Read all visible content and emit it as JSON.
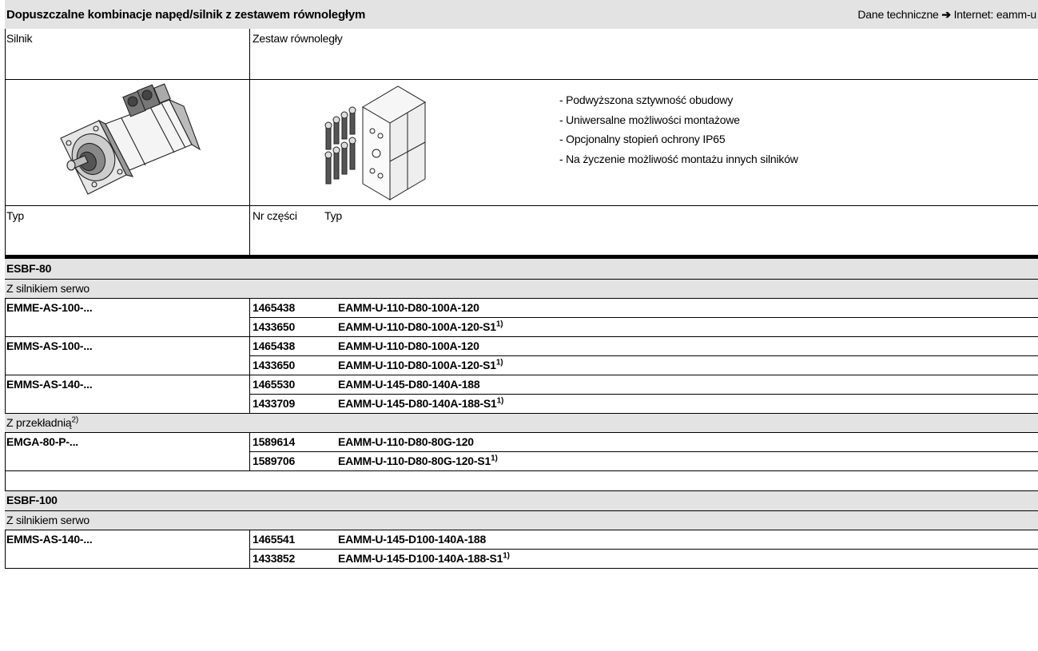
{
  "header": {
    "title": "Dopuszczalne kombinacje napęd/silnik z zestawem równoległym",
    "ref_prefix": "Dane techniczne",
    "ref_arrow": "➔",
    "ref_suffix": "Internet: eamm-u"
  },
  "columns": {
    "motor": "Silnik",
    "kit": "Zestaw równoległy",
    "type_left": "Typ",
    "part_no": "Nr części",
    "type_right": "Typ"
  },
  "features": [
    "- Podwyższona sztywność obudowy",
    "- Uniwersalne możliwości montażowe",
    "- Opcjonalny stopień ochrony IP65",
    "- Na życzenie możliwość montażu innych silników"
  ],
  "sections": {
    "esbf80": {
      "title": "ESBF-80",
      "servo_label": "Z silnikiem serwo",
      "gear_label": "Z przekładnią",
      "gear_note": "2)",
      "rows": [
        {
          "motor": "EMME-AS-100-...",
          "part": "1465438",
          "type": "EAMM-U-110-D80-100A-120",
          "note": ""
        },
        {
          "motor": "",
          "part": "1433650",
          "type": "EAMM-U-110-D80-100A-120-S1",
          "note": "1)"
        },
        {
          "motor": "EMMS-AS-100-...",
          "part": "1465438",
          "type": "EAMM-U-110-D80-100A-120",
          "note": ""
        },
        {
          "motor": "",
          "part": "1433650",
          "type": "EAMM-U-110-D80-100A-120-S1",
          "note": "1)"
        },
        {
          "motor": "EMMS-AS-140-...",
          "part": "1465530",
          "type": "EAMM-U-145-D80-140A-188",
          "note": ""
        },
        {
          "motor": "",
          "part": "1433709",
          "type": "EAMM-U-145-D80-140A-188-S1",
          "note": "1)"
        },
        {
          "motor": "EMGA-80-P-...",
          "part": "1589614",
          "type": "EAMM-U-110-D80-80G-120",
          "note": ""
        },
        {
          "motor": "",
          "part": "1589706",
          "type": "EAMM-U-110-D80-80G-120-S1",
          "note": "1)"
        }
      ]
    },
    "esbf100": {
      "title": "ESBF-100",
      "servo_label": "Z silnikiem serwo",
      "rows": [
        {
          "motor": "EMMS-AS-140-...",
          "part": "1465541",
          "type": "EAMM-U-145-D100-140A-188",
          "note": ""
        },
        {
          "motor": "",
          "part": "1433852",
          "type": "EAMM-U-145-D100-140A-188-S1",
          "note": "1)"
        }
      ]
    }
  }
}
